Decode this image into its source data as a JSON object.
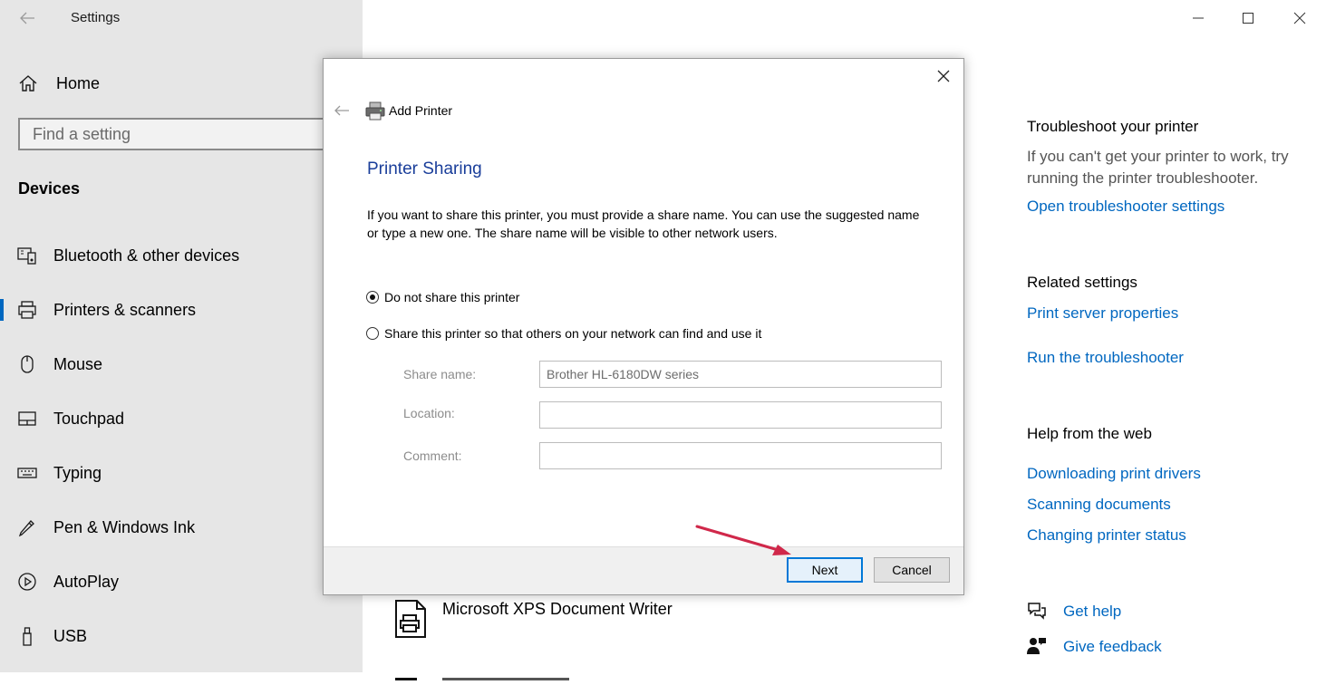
{
  "window": {
    "title": "Settings",
    "controls": [
      "minimize",
      "maximize",
      "close"
    ]
  },
  "sidebar": {
    "home_label": "Home",
    "search_placeholder": "Find a setting",
    "section_title": "Devices",
    "items": [
      {
        "label": "Bluetooth & other devices",
        "icon": "bluetooth-devices-icon"
      },
      {
        "label": "Printers & scanners",
        "icon": "printer-icon",
        "active": true
      },
      {
        "label": "Mouse",
        "icon": "mouse-icon"
      },
      {
        "label": "Touchpad",
        "icon": "touchpad-icon"
      },
      {
        "label": "Typing",
        "icon": "keyboard-icon"
      },
      {
        "label": "Pen & Windows Ink",
        "icon": "pen-icon"
      },
      {
        "label": "AutoPlay",
        "icon": "autoplay-icon"
      },
      {
        "label": "USB",
        "icon": "usb-icon"
      }
    ]
  },
  "main": {
    "printer_item": "Microsoft XPS Document Writer"
  },
  "right": {
    "troubleshoot_title": "Troubleshoot your printer",
    "troubleshoot_text": "If you can't get your printer to work, try running the printer troubleshooter.",
    "troubleshoot_link": "Open troubleshooter settings",
    "related_title": "Related settings",
    "related_links": [
      "Print server properties",
      "Run the troubleshooter"
    ],
    "help_title": "Help from the web",
    "help_links": [
      "Downloading print drivers",
      "Scanning documents",
      "Changing printer status"
    ],
    "get_help": "Get help",
    "give_feedback": "Give feedback"
  },
  "dialog": {
    "title": "Add Printer",
    "heading": "Printer Sharing",
    "description": "If you want to share this printer, you must provide a share name. You can use the suggested name or type a new one. The share name will be visible to other network users.",
    "options": [
      {
        "label": "Do not share this printer",
        "checked": true
      },
      {
        "label": "Share this printer so that others on your network can find and use it",
        "checked": false
      }
    ],
    "fields": [
      {
        "label": "Share name:",
        "value": "Brother HL-6180DW series"
      },
      {
        "label": "Location:",
        "value": ""
      },
      {
        "label": "Comment:",
        "value": ""
      }
    ],
    "next_label": "Next",
    "cancel_label": "Cancel"
  },
  "colors": {
    "accent": "#0067c0",
    "dialog_heading": "#1a3e9a",
    "annotation_arrow": "#d0284a"
  }
}
